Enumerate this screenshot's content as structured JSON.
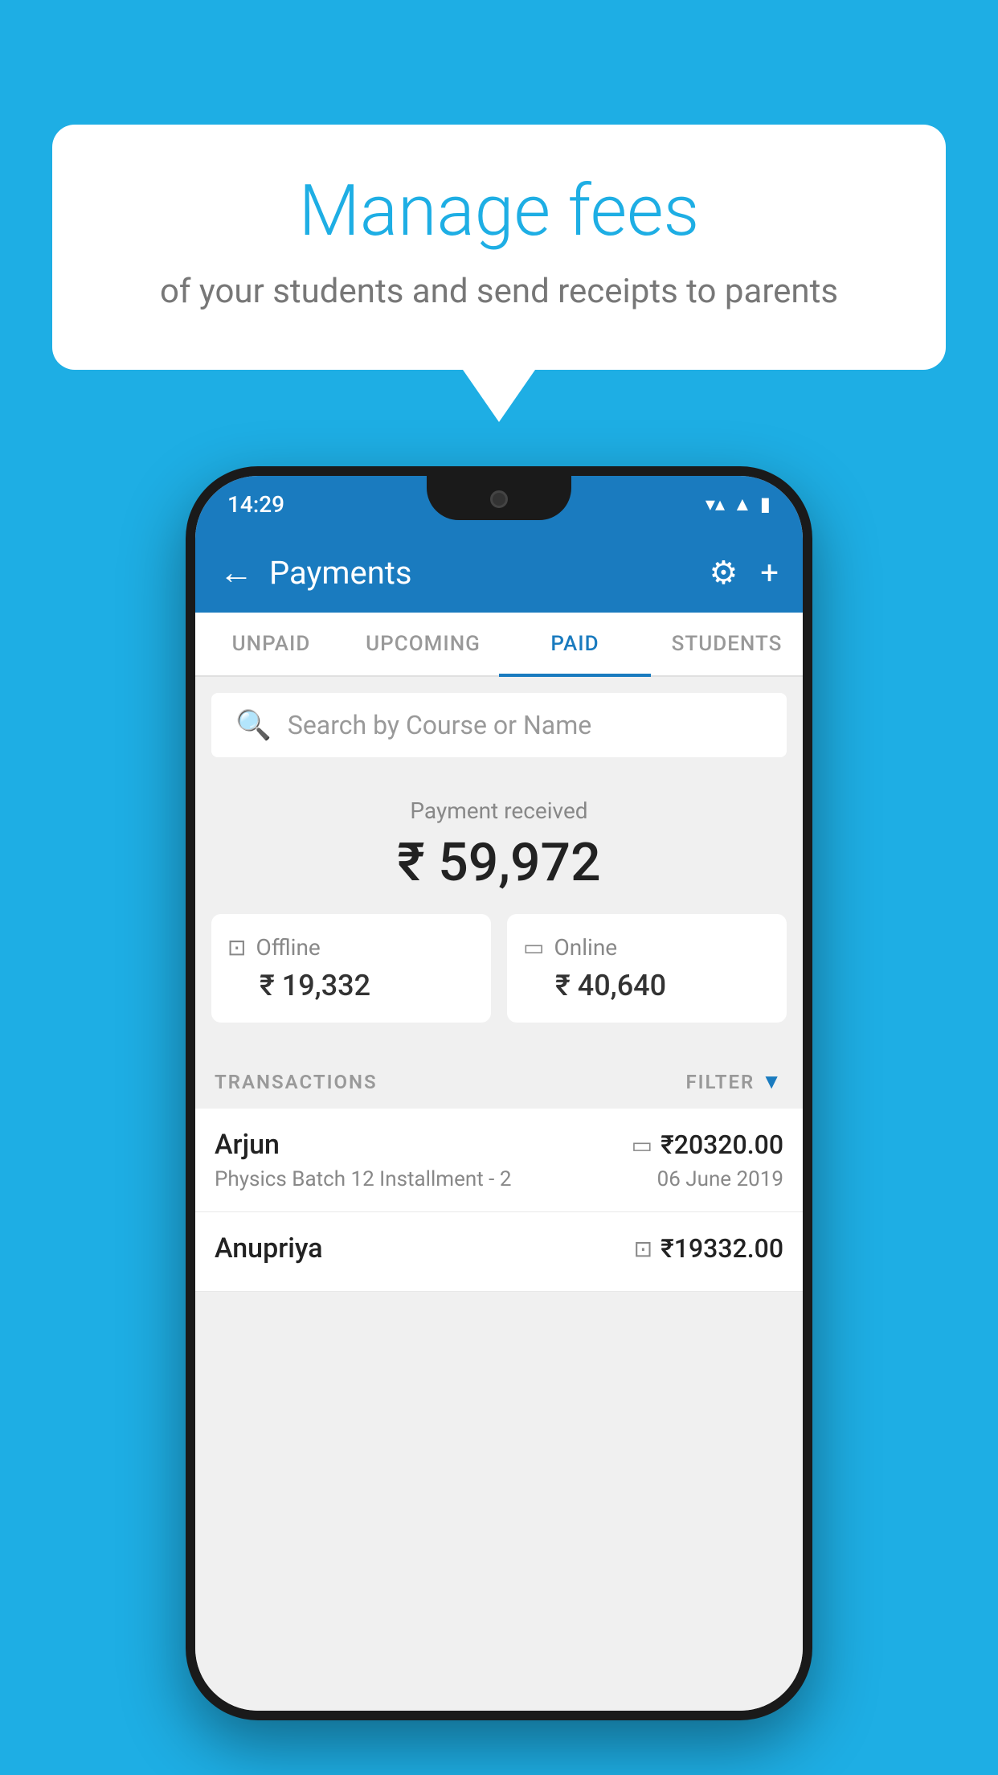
{
  "background": {
    "color": "#1EAEE4"
  },
  "speech_bubble": {
    "title": "Manage fees",
    "subtitle": "of your students and send receipts to parents"
  },
  "status_bar": {
    "time": "14:29",
    "wifi_icon": "▾",
    "signal_icon": "▲",
    "battery_icon": "▮"
  },
  "app_bar": {
    "title": "Payments",
    "back_label": "←",
    "gear_label": "⚙",
    "plus_label": "+"
  },
  "tabs": [
    {
      "label": "UNPAID",
      "active": false
    },
    {
      "label": "UPCOMING",
      "active": false
    },
    {
      "label": "PAID",
      "active": true
    },
    {
      "label": "STUDENTS",
      "active": false
    }
  ],
  "search": {
    "placeholder": "Search by Course or Name"
  },
  "payment": {
    "label": "Payment received",
    "amount": "₹ 59,972",
    "offline_label": "Offline",
    "offline_amount": "₹ 19,332",
    "online_label": "Online",
    "online_amount": "₹ 40,640"
  },
  "transactions_header": {
    "label": "TRANSACTIONS",
    "filter_label": "FILTER"
  },
  "transactions": [
    {
      "name": "Arjun",
      "course": "Physics Batch 12 Installment - 2",
      "amount": "₹20320.00",
      "date": "06 June 2019",
      "mode": "online"
    },
    {
      "name": "Anupriya",
      "course": "",
      "amount": "₹19332.00",
      "date": "",
      "mode": "offline"
    }
  ]
}
